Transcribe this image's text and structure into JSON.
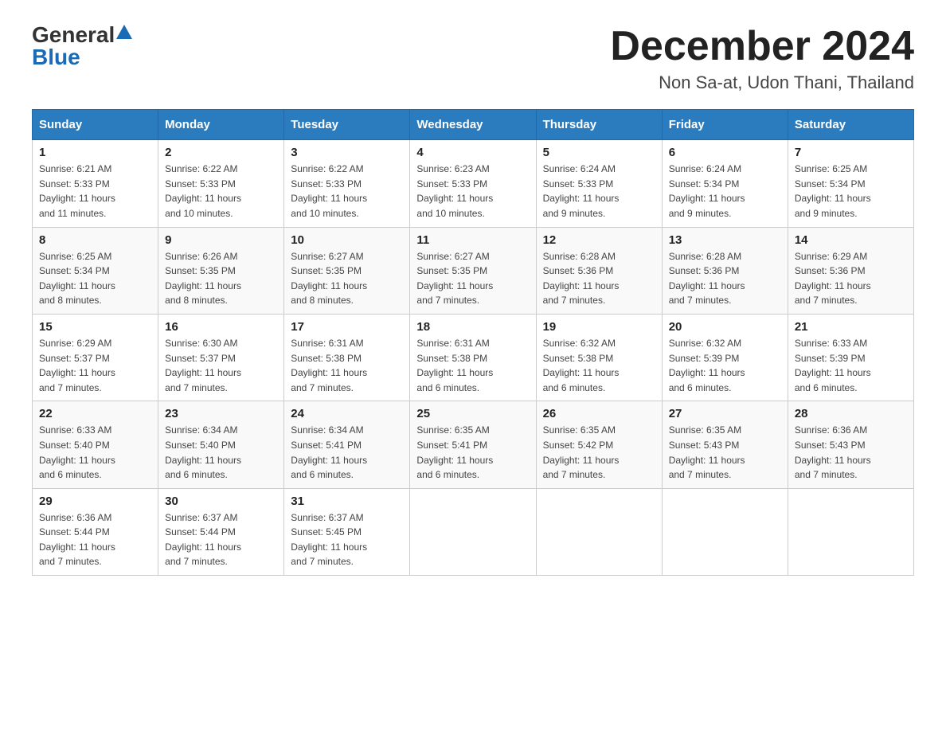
{
  "logo": {
    "general": "General",
    "blue": "Blue"
  },
  "title": "December 2024",
  "subtitle": "Non Sa-at, Udon Thani, Thailand",
  "headers": [
    "Sunday",
    "Monday",
    "Tuesday",
    "Wednesday",
    "Thursday",
    "Friday",
    "Saturday"
  ],
  "weeks": [
    [
      {
        "day": "1",
        "sunrise": "6:21 AM",
        "sunset": "5:33 PM",
        "daylight": "11 hours and 11 minutes."
      },
      {
        "day": "2",
        "sunrise": "6:22 AM",
        "sunset": "5:33 PM",
        "daylight": "11 hours and 10 minutes."
      },
      {
        "day": "3",
        "sunrise": "6:22 AM",
        "sunset": "5:33 PM",
        "daylight": "11 hours and 10 minutes."
      },
      {
        "day": "4",
        "sunrise": "6:23 AM",
        "sunset": "5:33 PM",
        "daylight": "11 hours and 10 minutes."
      },
      {
        "day": "5",
        "sunrise": "6:24 AM",
        "sunset": "5:33 PM",
        "daylight": "11 hours and 9 minutes."
      },
      {
        "day": "6",
        "sunrise": "6:24 AM",
        "sunset": "5:34 PM",
        "daylight": "11 hours and 9 minutes."
      },
      {
        "day": "7",
        "sunrise": "6:25 AM",
        "sunset": "5:34 PM",
        "daylight": "11 hours and 9 minutes."
      }
    ],
    [
      {
        "day": "8",
        "sunrise": "6:25 AM",
        "sunset": "5:34 PM",
        "daylight": "11 hours and 8 minutes."
      },
      {
        "day": "9",
        "sunrise": "6:26 AM",
        "sunset": "5:35 PM",
        "daylight": "11 hours and 8 minutes."
      },
      {
        "day": "10",
        "sunrise": "6:27 AM",
        "sunset": "5:35 PM",
        "daylight": "11 hours and 8 minutes."
      },
      {
        "day": "11",
        "sunrise": "6:27 AM",
        "sunset": "5:35 PM",
        "daylight": "11 hours and 7 minutes."
      },
      {
        "day": "12",
        "sunrise": "6:28 AM",
        "sunset": "5:36 PM",
        "daylight": "11 hours and 7 minutes."
      },
      {
        "day": "13",
        "sunrise": "6:28 AM",
        "sunset": "5:36 PM",
        "daylight": "11 hours and 7 minutes."
      },
      {
        "day": "14",
        "sunrise": "6:29 AM",
        "sunset": "5:36 PM",
        "daylight": "11 hours and 7 minutes."
      }
    ],
    [
      {
        "day": "15",
        "sunrise": "6:29 AM",
        "sunset": "5:37 PM",
        "daylight": "11 hours and 7 minutes."
      },
      {
        "day": "16",
        "sunrise": "6:30 AM",
        "sunset": "5:37 PM",
        "daylight": "11 hours and 7 minutes."
      },
      {
        "day": "17",
        "sunrise": "6:31 AM",
        "sunset": "5:38 PM",
        "daylight": "11 hours and 7 minutes."
      },
      {
        "day": "18",
        "sunrise": "6:31 AM",
        "sunset": "5:38 PM",
        "daylight": "11 hours and 6 minutes."
      },
      {
        "day": "19",
        "sunrise": "6:32 AM",
        "sunset": "5:38 PM",
        "daylight": "11 hours and 6 minutes."
      },
      {
        "day": "20",
        "sunrise": "6:32 AM",
        "sunset": "5:39 PM",
        "daylight": "11 hours and 6 minutes."
      },
      {
        "day": "21",
        "sunrise": "6:33 AM",
        "sunset": "5:39 PM",
        "daylight": "11 hours and 6 minutes."
      }
    ],
    [
      {
        "day": "22",
        "sunrise": "6:33 AM",
        "sunset": "5:40 PM",
        "daylight": "11 hours and 6 minutes."
      },
      {
        "day": "23",
        "sunrise": "6:34 AM",
        "sunset": "5:40 PM",
        "daylight": "11 hours and 6 minutes."
      },
      {
        "day": "24",
        "sunrise": "6:34 AM",
        "sunset": "5:41 PM",
        "daylight": "11 hours and 6 minutes."
      },
      {
        "day": "25",
        "sunrise": "6:35 AM",
        "sunset": "5:41 PM",
        "daylight": "11 hours and 6 minutes."
      },
      {
        "day": "26",
        "sunrise": "6:35 AM",
        "sunset": "5:42 PM",
        "daylight": "11 hours and 7 minutes."
      },
      {
        "day": "27",
        "sunrise": "6:35 AM",
        "sunset": "5:43 PM",
        "daylight": "11 hours and 7 minutes."
      },
      {
        "day": "28",
        "sunrise": "6:36 AM",
        "sunset": "5:43 PM",
        "daylight": "11 hours and 7 minutes."
      }
    ],
    [
      {
        "day": "29",
        "sunrise": "6:36 AM",
        "sunset": "5:44 PM",
        "daylight": "11 hours and 7 minutes."
      },
      {
        "day": "30",
        "sunrise": "6:37 AM",
        "sunset": "5:44 PM",
        "daylight": "11 hours and 7 minutes."
      },
      {
        "day": "31",
        "sunrise": "6:37 AM",
        "sunset": "5:45 PM",
        "daylight": "11 hours and 7 minutes."
      },
      null,
      null,
      null,
      null
    ]
  ],
  "labels": {
    "sunrise": "Sunrise:",
    "sunset": "Sunset:",
    "daylight": "Daylight:"
  }
}
